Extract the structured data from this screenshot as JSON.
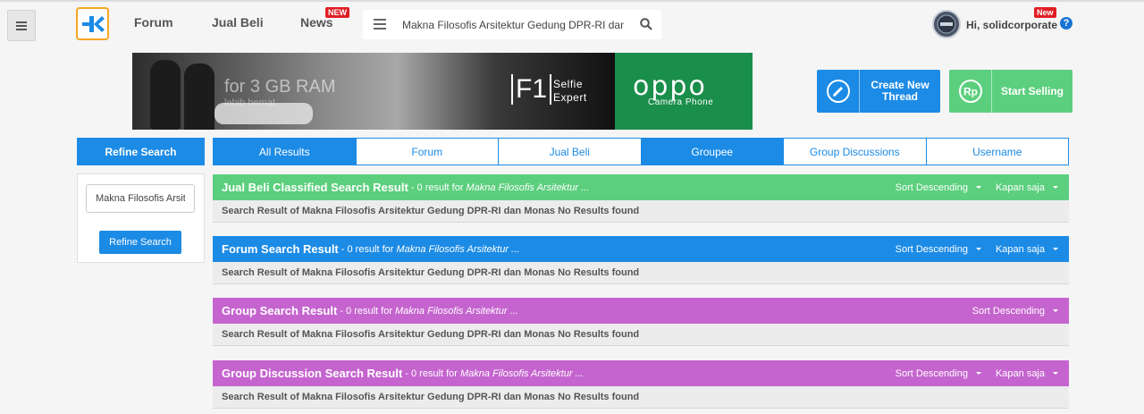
{
  "nav": {
    "forum_label": "Forum",
    "jualbeli_label": "Jual Beli",
    "news_label": "News",
    "news_badge": "NEW",
    "search_value": "Makna Filosofis Arsitektur Gedung DPR-RI dan Monas",
    "greeting": "Hi, solidcorporate",
    "user_badge": "New",
    "help_label": "?"
  },
  "banner": {
    "headline": "for 3 GB RAM",
    "subline": "lebih hemat",
    "model": "F1",
    "tagline": "Selfie Expert",
    "brand": "oppo",
    "brand_sub": "Camera Phone"
  },
  "actions": {
    "create_thread": "Create New Thread",
    "start_selling": "Start Selling"
  },
  "sidebar": {
    "heading": "Refine Search",
    "input_value": "Makna Filosofis Arsitektur Gedung DPR-RI dan Monas",
    "button_label": "Refine Search"
  },
  "tabs": [
    {
      "label": "All Results",
      "active": true
    },
    {
      "label": "Forum",
      "active": false
    },
    {
      "label": "Jual Beli",
      "active": false
    },
    {
      "label": "Groupee",
      "active": true
    },
    {
      "label": "Group Discussions",
      "active": false
    },
    {
      "label": "Username",
      "active": false
    }
  ],
  "sections": [
    {
      "title": "Jual Beli Classified Search Result",
      "count": "- 0 result for",
      "query": "Makna Filosofis Arsitektur ...",
      "sort": "Sort Descending",
      "time": "Kapan saja",
      "message": "Search Result of Makna Filosofis Arsitektur Gedung DPR-RI dan Monas No Results found",
      "color": "#5ccf7e"
    },
    {
      "title": "Forum Search Result",
      "count": "- 0 result for",
      "query": "Makna Filosofis Arsitektur ...",
      "sort": "Sort Descending",
      "time": "Kapan saja",
      "message": "Search Result of Makna Filosofis Arsitektur Gedung DPR-RI dan Monas No Results found",
      "color": "#1c8be6"
    },
    {
      "title": "Group Search Result",
      "count": "- 0 result for",
      "query": "Makna Filosofis Arsitektur ...",
      "sort": "Sort Descending",
      "message": "Search Result of Makna Filosofis Arsitektur Gedung DPR-RI dan Monas No Results found",
      "color": "#c564cf"
    },
    {
      "title": "Group Discussion Search Result",
      "count": "- 0 result for",
      "query": "Makna Filosofis Arsitektur ...",
      "sort": "Sort Descending",
      "time": "Kapan saja",
      "message": "Search Result of Makna Filosofis Arsitektur Gedung DPR-RI dan Monas No Results found",
      "color": "#c564cf"
    }
  ],
  "icons": {
    "menu": "hamburger-icon",
    "logo": "kaskus-logo-icon",
    "search": "search-icon",
    "pencil": "pencil-icon",
    "rupiah": "rupiah-icon",
    "help": "help-icon"
  }
}
